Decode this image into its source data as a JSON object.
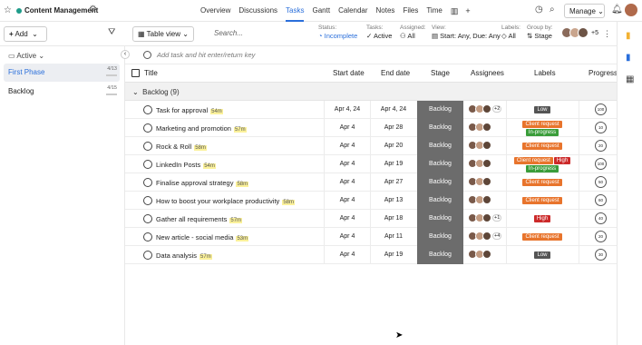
{
  "header": {
    "project_title": "Content Management",
    "nav_tabs": [
      "Overview",
      "Discussions",
      "Tasks",
      "Gantt",
      "Calendar",
      "Notes",
      "Files",
      "Time"
    ],
    "active_tab": "Tasks",
    "manage_label": "Manage"
  },
  "toolbar": {
    "add_label": "Add",
    "view_label": "Table view",
    "search_placeholder": "Search...",
    "filters": [
      {
        "label": "Status:",
        "value": "Incomplete"
      },
      {
        "label": "Tasks:",
        "value": "Active"
      },
      {
        "label": "Assigned:",
        "value": "All"
      },
      {
        "label": "View:",
        "value": "Start: Any, Due: Any"
      },
      {
        "label": "Labels:",
        "value": "All"
      },
      {
        "label": "Group by:",
        "value": "Stage"
      }
    ],
    "member_more": "+5"
  },
  "sidebar": {
    "filter_label": "Active",
    "phases": [
      {
        "name": "First Phase",
        "count": "4/13"
      },
      {
        "name": "Backlog",
        "count": "4/15"
      }
    ]
  },
  "table": {
    "add_placeholder": "Add task and hit enter/return key",
    "columns": [
      "Title",
      "Start date",
      "End date",
      "Stage",
      "Assignees",
      "Labels",
      "Progress"
    ],
    "group_title": "Backlog (9)",
    "rows": [
      {
        "title": "Task for approval",
        "dur": "54m",
        "start": "Apr 4, 24",
        "end": "Apr 4, 24",
        "stage": "Backlog",
        "extra": "+2",
        "labels": [
          {
            "t": "Low",
            "c": "#555555"
          }
        ],
        "progress": "100"
      },
      {
        "title": "Marketing and promotion",
        "dur": "57m",
        "start": "Apr 4",
        "end": "Apr 28",
        "stage": "Backlog",
        "extra": "",
        "labels": [
          {
            "t": "Client request",
            "c": "#e8742c"
          },
          {
            "t": "In-progress",
            "c": "#3a9d3a"
          }
        ],
        "progress": "10"
      },
      {
        "title": "Rock & Roll",
        "dur": "58m",
        "start": "Apr 4",
        "end": "Apr 20",
        "stage": "Backlog",
        "extra": "",
        "labels": [
          {
            "t": "Client request",
            "c": "#e8742c"
          }
        ],
        "progress": "20"
      },
      {
        "title": "LinkedIn Posts",
        "dur": "54m",
        "start": "Apr 4",
        "end": "Apr 19",
        "stage": "Backlog",
        "extra": "",
        "labels": [
          {
            "t": "Client request",
            "c": "#e8742c"
          },
          {
            "t": "High",
            "c": "#cc2a2a"
          },
          {
            "t": "In-progress",
            "c": "#3a9d3a"
          }
        ],
        "progress": "100"
      },
      {
        "title": "Finalise approval strategy",
        "dur": "58m",
        "start": "Apr 4",
        "end": "Apr 27",
        "stage": "Backlog",
        "extra": "",
        "labels": [
          {
            "t": "Client request",
            "c": "#e8742c"
          }
        ],
        "progress": "50"
      },
      {
        "title": "How to boost your workplace productivity",
        "dur": "58m",
        "start": "Apr 4",
        "end": "Apr 13",
        "stage": "Backlog",
        "extra": "",
        "labels": [
          {
            "t": "Client request",
            "c": "#e8742c"
          }
        ],
        "progress": "60"
      },
      {
        "title": "Gather all requirements",
        "dur": "57m",
        "start": "Apr 4",
        "end": "Apr 18",
        "stage": "Backlog",
        "extra": "+1",
        "labels": [
          {
            "t": "High",
            "c": "#cc2a2a"
          }
        ],
        "progress": "40"
      },
      {
        "title": "New article - social media",
        "dur": "53m",
        "start": "Apr 4",
        "end": "Apr 11",
        "stage": "Backlog",
        "extra": "+4",
        "labels": [
          {
            "t": "Client request",
            "c": "#e8742c"
          }
        ],
        "progress": "20"
      },
      {
        "title": "Data analysis",
        "dur": "57m",
        "start": "Apr 4",
        "end": "Apr 19",
        "stage": "Backlog",
        "extra": "",
        "labels": [
          {
            "t": "Low",
            "c": "#555555"
          }
        ],
        "progress": "30"
      }
    ]
  }
}
